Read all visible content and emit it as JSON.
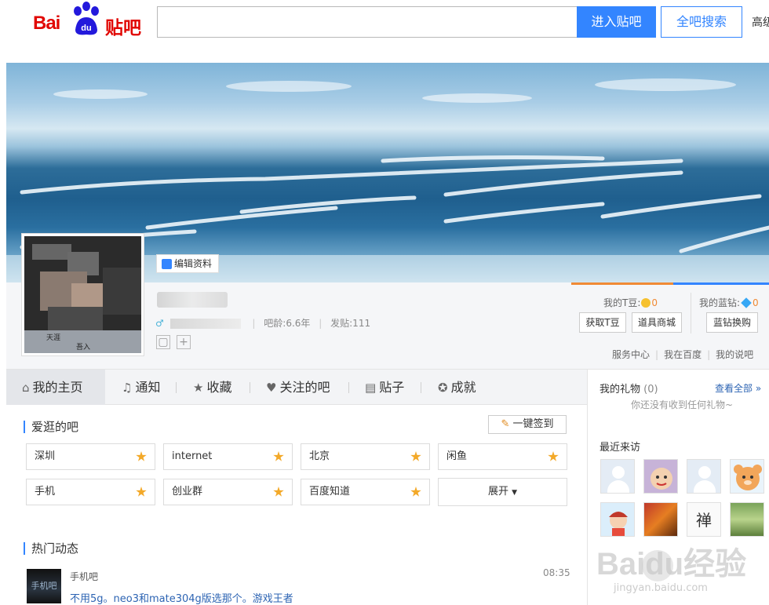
{
  "header": {
    "logo_text_bai": "Bai",
    "logo_text_du": "du",
    "logo_text_tieba": "贴吧",
    "search_placeholder": "",
    "enter_button": "进入贴吧",
    "search_all_button": "全吧搜索",
    "advanced": "高级"
  },
  "profile": {
    "edit_button": "编辑资料",
    "gender_symbol": "♂",
    "bar_age": "吧龄:6.6年",
    "posts": "发贴:111",
    "tdou_label": "我的T豆:",
    "tdou_value": "0",
    "lanzuan_label": "我的蓝钻:",
    "lanzuan_value": "0",
    "get_tdou_button": "获取T豆",
    "shop_button": "道具商城",
    "exchange_button": "蓝钻换购",
    "service_links": [
      "服务中心",
      "我在百度",
      "我的说吧"
    ],
    "avatar_caption_left": "天涯",
    "avatar_caption_right": "吾入"
  },
  "tabs": [
    {
      "icon": "home-icon",
      "glyph": "⌂",
      "label": "我的主页"
    },
    {
      "icon": "bell-icon",
      "glyph": "🔔",
      "label": "通知"
    },
    {
      "icon": "star-icon",
      "glyph": "★",
      "label": "收藏"
    },
    {
      "icon": "heart-icon",
      "glyph": "♥",
      "label": "关注的吧"
    },
    {
      "icon": "document-icon",
      "glyph": "▤",
      "label": "贴子"
    },
    {
      "icon": "medal-icon",
      "glyph": "✪",
      "label": "成就"
    }
  ],
  "favorites": {
    "title": "爱逛的吧",
    "sign_button": "一键签到",
    "forums": [
      "深圳",
      "internet",
      "北京",
      "闲鱼",
      "手机",
      "创业群",
      "百度知道"
    ],
    "expand_button": "展开"
  },
  "feed": {
    "title": "热门动态",
    "item": {
      "thumb_text": "手机吧",
      "source": "手机吧",
      "time": "08:35",
      "headline": "不用5g。neo3和mate304g版选那个。游戏王者"
    }
  },
  "sidebar": {
    "gifts_title": "我的礼物",
    "gifts_count": "(0)",
    "see_all": "查看全部 »",
    "gifts_empty": "你还没有收到任何礼物~",
    "visitors_title": "最近来访",
    "visitor_8_text": "禅"
  },
  "watermark": {
    "text": "Baidu经验",
    "url": "jingyan.baidu.com"
  },
  "colors": {
    "brand_red": "#e10602",
    "accent_blue": "#3385ff",
    "tdou_orange": "#f08a35",
    "link_blue": "#2d64b3"
  }
}
